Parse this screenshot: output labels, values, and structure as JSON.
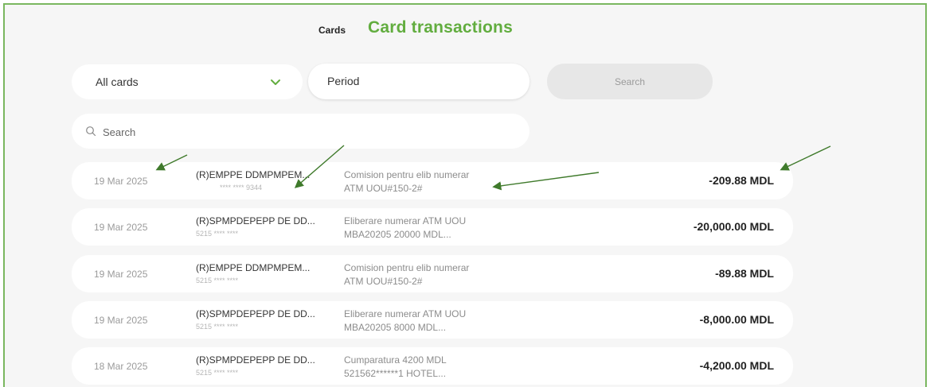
{
  "header": {
    "breadcrumb": "Cards",
    "title": "Card transactions"
  },
  "filters": {
    "card_select": "All cards",
    "period_label": "Period",
    "search_button": "Search"
  },
  "search": {
    "placeholder": "Search"
  },
  "transactions": [
    {
      "date": "19 Mar 2025",
      "merchant": "(R)EMPPE DDMPMPEM...",
      "card": "**** **** 9344",
      "desc1": "Comision pentru elib numerar",
      "desc2": "ATM UOU#150-2#",
      "amount": "-209.88 MDL"
    },
    {
      "date": "19 Mar 2025",
      "merchant": "(R)SPMPDEPEPP DE DD...",
      "card": "5215 **** ****",
      "desc1": "Eliberare numerar ATM UOU",
      "desc2": "MBA20205 20000 MDL...",
      "amount": "-20,000.00 MDL"
    },
    {
      "date": "19 Mar 2025",
      "merchant": "(R)EMPPE DDMPMPEM...",
      "card": "5215 **** ****",
      "desc1": "Comision pentru elib numerar",
      "desc2": "ATM UOU#150-2#",
      "amount": "-89.88 MDL"
    },
    {
      "date": "19 Mar 2025",
      "merchant": "(R)SPMPDEPEPP DE DD...",
      "card": "5215 **** ****",
      "desc1": "Eliberare numerar ATM UOU",
      "desc2": "MBA20205 8000 MDL...",
      "amount": "-8,000.00 MDL"
    },
    {
      "date": "18 Mar 2025",
      "merchant": "(R)SPMPDEPEPP DE DD...",
      "card": "5215 **** ****",
      "desc1": "Cumparatura 4200 MDL",
      "desc2": "521562******1      HOTEL...",
      "amount": "-4,200.00 MDL"
    }
  ],
  "colors": {
    "accent": "#62ad3f",
    "frame_border": "#7ab75f",
    "arrow": "#3f7a2b"
  },
  "icons": {
    "dropdown": "chevron-down-icon",
    "search": "search-icon"
  }
}
